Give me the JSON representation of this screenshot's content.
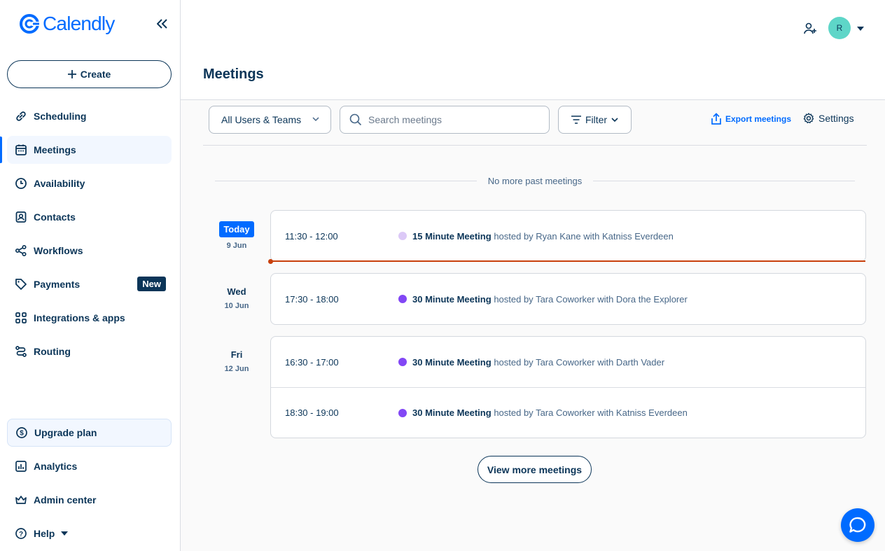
{
  "app": {
    "logo_text": "Calendly"
  },
  "sidebar": {
    "create_label": "Create",
    "items": [
      {
        "label": "Scheduling"
      },
      {
        "label": "Meetings"
      },
      {
        "label": "Availability"
      },
      {
        "label": "Contacts"
      },
      {
        "label": "Workflows"
      },
      {
        "label": "Payments",
        "badge": "New"
      },
      {
        "label": "Integrations & apps"
      },
      {
        "label": "Routing"
      }
    ],
    "bottom": {
      "upgrade": "Upgrade plan",
      "analytics": "Analytics",
      "admin": "Admin center",
      "help": "Help"
    }
  },
  "header": {
    "title": "Meetings",
    "avatar_initial": "R"
  },
  "toolbar": {
    "scope_dropdown": "All Users & Teams",
    "search_placeholder": "Search meetings",
    "filter_label": "Filter",
    "export_label": "Export meetings",
    "settings_label": "Settings"
  },
  "list": {
    "no_more": "No more past meetings",
    "groups": [
      {
        "day": "Today",
        "date": "9 Jun",
        "meetings": [
          {
            "time": "11:30 - 12:00",
            "title": "15 Minute Meeting",
            "detail": "hosted by Ryan Kane with Katniss Everdeen",
            "color": "#dcc9f7"
          }
        ]
      },
      {
        "day": "Wed",
        "date": "10 Jun",
        "meetings": [
          {
            "time": "17:30 - 18:00",
            "title": "30 Minute Meeting",
            "detail": "hosted by Tara Coworker with Dora the Explorer",
            "color": "#8247f5"
          }
        ]
      },
      {
        "day": "Fri",
        "date": "12 Jun",
        "meetings": [
          {
            "time": "16:30 - 17:00",
            "title": "30 Minute Meeting",
            "detail": "hosted by Tara Coworker with Darth Vader",
            "color": "#8247f5"
          },
          {
            "time": "18:30 - 19:00",
            "title": "30 Minute Meeting",
            "detail": "hosted by Tara Coworker with Katniss Everdeen",
            "color": "#8247f5"
          }
        ]
      }
    ],
    "view_more": "View more meetings"
  },
  "colors": {
    "brand": "#006bff",
    "now_line": "#c8400b",
    "text": "#0b3558"
  }
}
